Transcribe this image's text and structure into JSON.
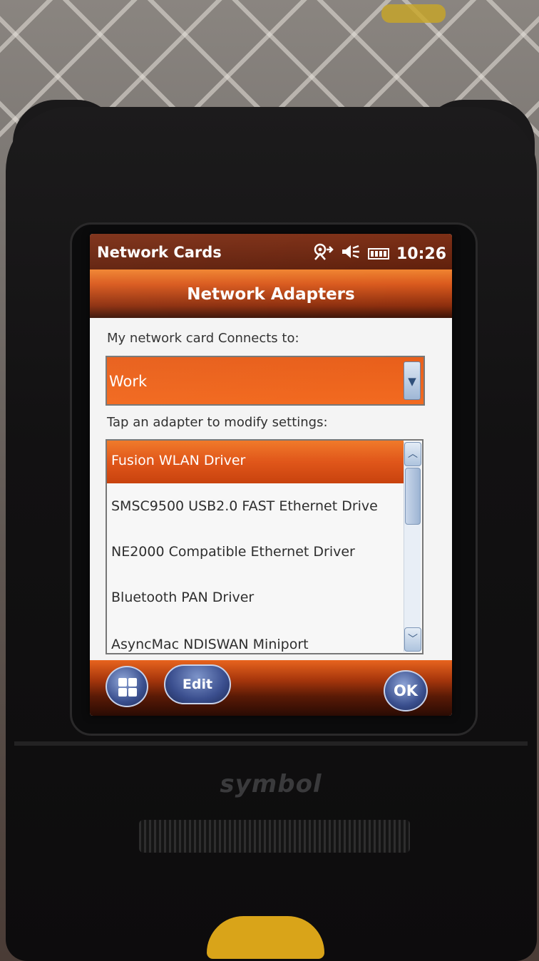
{
  "status_bar": {
    "app_title": "Network Cards",
    "time": "10:26",
    "icons": [
      "connectivity-icon",
      "volume-muted-icon",
      "battery-icon"
    ]
  },
  "header": {
    "title": "Network Adapters"
  },
  "connects_to": {
    "label": "My network card Connects to:",
    "selected_value": "Work"
  },
  "adapters": {
    "label": "Tap an adapter to modify settings:",
    "items": [
      {
        "label": "Fusion WLAN Driver",
        "selected": true
      },
      {
        "label": "SMSC9500 USB2.0 FAST Ethernet Drive",
        "selected": false
      },
      {
        "label": "NE2000 Compatible Ethernet Driver",
        "selected": false
      },
      {
        "label": "Bluetooth PAN Driver",
        "selected": false
      },
      {
        "label": "AsyncMac NDISWAN Miniport",
        "selected": false
      }
    ]
  },
  "softkeys": {
    "start_icon": "windows-start-icon",
    "edit_label": "Edit",
    "ok_label": "OK"
  },
  "device": {
    "brand": "symbol"
  },
  "colors": {
    "accent_orange": "#e85f1b",
    "title_dark": "#5e1c08",
    "button_blue": "#3a4f8e"
  }
}
